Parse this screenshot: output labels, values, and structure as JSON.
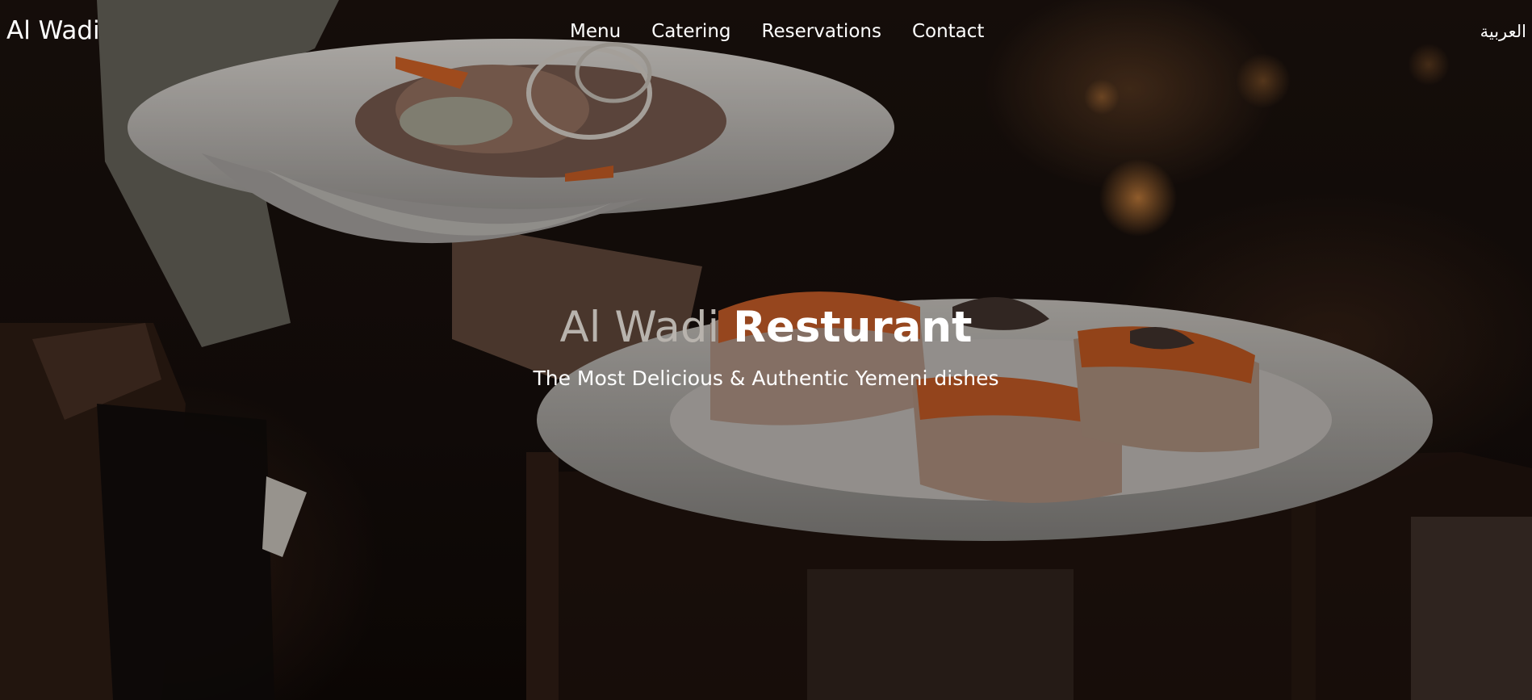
{
  "brand": {
    "name": "Al Wadi"
  },
  "nav": {
    "items": [
      {
        "label": "Menu"
      },
      {
        "label": "Catering"
      },
      {
        "label": "Reservations"
      },
      {
        "label": "Contact"
      }
    ],
    "language_label": "العربية"
  },
  "hero": {
    "title_part1": "Al Wadi",
    "title_part2": "Resturant",
    "subtitle": "The Most Delicious & Authentic Yemeni dishes"
  },
  "colors": {
    "text_primary": "#ffffff",
    "title_muted": "#b8b3ad",
    "background_dark": "#120b08"
  }
}
